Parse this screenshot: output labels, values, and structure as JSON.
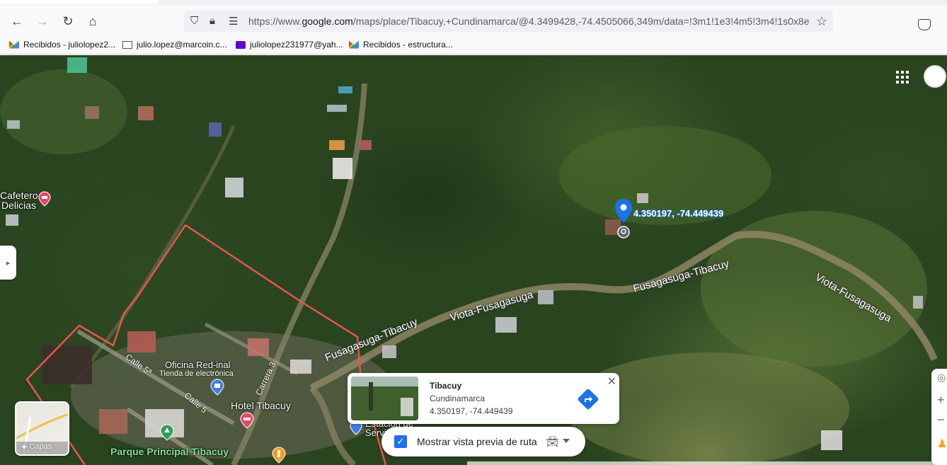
{
  "browser": {
    "url_prefix": "https://www.",
    "url_domain": "google.com",
    "url_rest": "/maps/place/Tibacuy,+Cundinamarca/@4.3499428,-74.4505066,349m/data=!3m1!1e3!4m5!3m4!1s0x8e",
    "bookmarks": [
      {
        "label": "Recibidos - juliolopez2...",
        "icon": "gmail-icon"
      },
      {
        "label": "julio.lopez@marcoin.c...",
        "icon": "mail-icon"
      },
      {
        "label": "juliolopez231977@yah...",
        "icon": "yahoo-icon"
      },
      {
        "label": "Recibidos - estructura...",
        "icon": "gmail-icon"
      }
    ]
  },
  "map": {
    "pin_coords": "4.350197, -74.449439",
    "labels": {
      "cafetero": "Cafetero",
      "delicias": "Delicias",
      "calle5a": "Calle 5ª",
      "calle5": "Calle 5",
      "carrera3": "Carrera 3",
      "oficina": "Oficina Red-inal",
      "tienda": "Tienda de electrónica",
      "hotel": "Hotel Tibacuy",
      "parque": "Parque Principal Tibacuy",
      "estacion": "Estación de",
      "servi": "Servi"
    },
    "roads": {
      "r1": "Fusagasuga-Tibacuy",
      "r2": "Viota-Fusagasuga",
      "r3": "Fusagasuga-Tibacuy",
      "r4": "Viota-Fusagasuga"
    },
    "layers_label": "Capas",
    "colors": {
      "boundary": "#e8554a",
      "pin": "#1a73e8",
      "accent": "#1a73e8"
    }
  },
  "place_card": {
    "title": "Tibacuy",
    "region": "Cundinamarca",
    "coords": "4.350197, -74.449439"
  },
  "route_preview": {
    "label": "Mostrar vista previa de ruta",
    "checked": true
  }
}
